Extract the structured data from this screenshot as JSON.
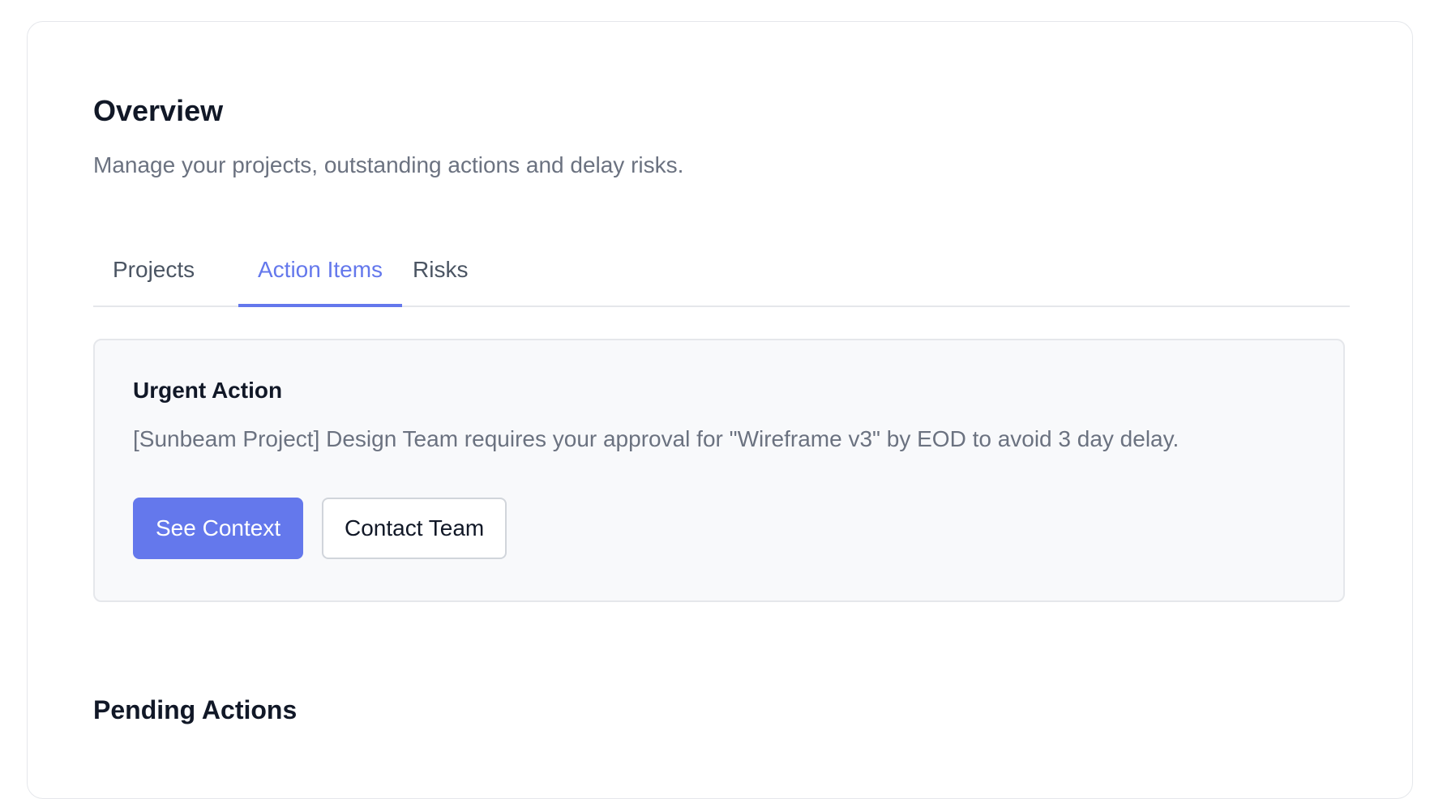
{
  "header": {
    "title": "Overview",
    "subtitle": "Manage your projects, outstanding actions and delay risks."
  },
  "tabs": [
    {
      "label": "Projects",
      "active": false
    },
    {
      "label": "Action Items",
      "active": true
    },
    {
      "label": "Risks",
      "active": false
    }
  ],
  "urgent_action": {
    "title": "Urgent Action",
    "message": "[Sunbeam Project] Design Team requires your approval for \"Wireframe v3\" by EOD to avoid 3 day delay.",
    "primary_button": "See Context",
    "secondary_button": "Contact Team"
  },
  "pending_actions": {
    "title": "Pending Actions"
  },
  "colors": {
    "accent": "#6478ec",
    "text_primary": "#111827",
    "text_muted": "#6b7280",
    "border": "#e5e7eb",
    "panel_background": "#f8f9fb"
  }
}
